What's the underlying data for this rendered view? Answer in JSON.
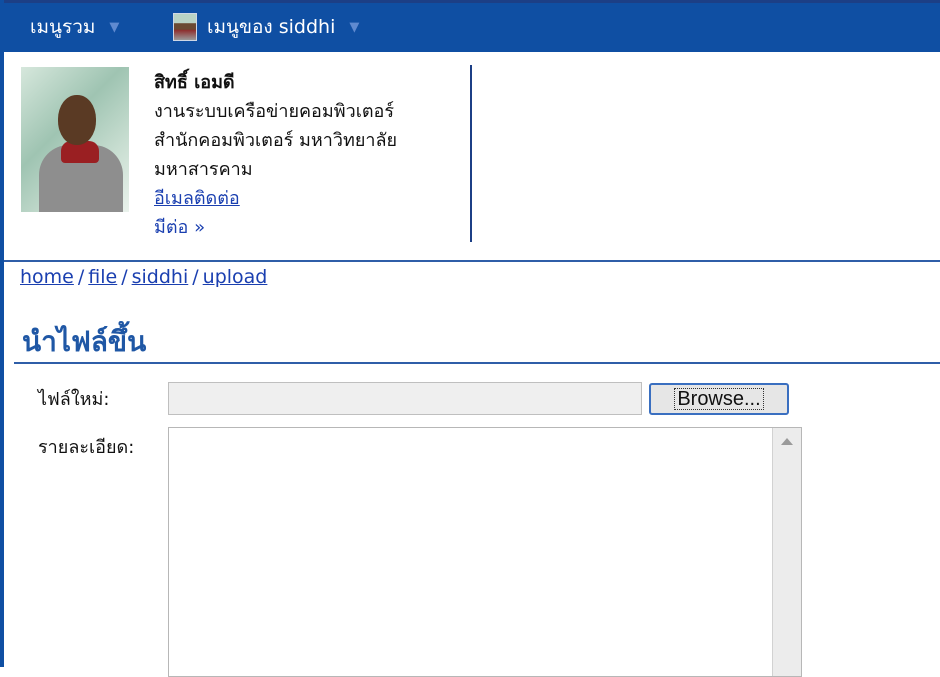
{
  "nav": {
    "all_menu": "เมนูรวม",
    "my_menu": "เมนูของ siddhi",
    "chevron_icon": "chevron-down-icon",
    "avatar_icon": "user-avatar"
  },
  "profile": {
    "name": "สิทธิ์ เอมดี",
    "line1": "งานระบบเครือข่ายคอมพิวเตอร์",
    "line2": "สำนักคอมพิวเตอร์ มหาวิทยาลัย",
    "line3": "มหาสารคาม",
    "email_link": "อีเมลติดต่อ",
    "more_link": "มีต่อ »"
  },
  "breadcrumb": {
    "items": [
      "home",
      "file",
      "siddhi",
      "upload"
    ],
    "separator": "/"
  },
  "page": {
    "title": "นำไฟล์ขึ้น"
  },
  "form": {
    "new_file_label": "ไฟล์ใหม่:",
    "file_value": "",
    "browse_label": "Browse...",
    "detail_label": "รายละเอียด:",
    "detail_value": ""
  },
  "colors": {
    "nav_bg": "#0f4fa3",
    "link": "#1a3fb0",
    "title": "#1f57a5"
  }
}
